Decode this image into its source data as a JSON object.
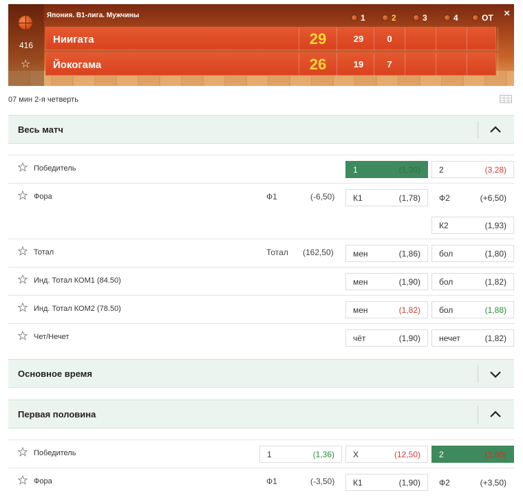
{
  "scoreboard": {
    "league": "Япония. B1-лига. Мужчины",
    "match_id": "416",
    "periods": [
      "1",
      "2",
      "3",
      "4",
      "OT"
    ],
    "teams": [
      {
        "name": "Ниигата",
        "score": "29",
        "q": [
          "29",
          "0",
          "",
          "",
          ""
        ]
      },
      {
        "name": "Йокогама",
        "score": "26",
        "q": [
          "19",
          "7",
          "",
          "",
          ""
        ]
      }
    ],
    "close": "×",
    "star": "☆"
  },
  "match_time": "07 мин 2-я четверть",
  "sections": {
    "whole_match": "Весь матч",
    "regular_time": "Основное время",
    "first_half": "Первая половина"
  },
  "markets": {
    "winner": {
      "name": "Победитель",
      "o1_label": "1",
      "o1": "(1,30)",
      "o2_label": "2",
      "o2": "(3,28)"
    },
    "handicap": {
      "name": "Фора",
      "p1_label": "Ф1",
      "p1": "(-6,50)",
      "k1_label": "К1",
      "k1": "(1,78)",
      "p2_label": "Ф2",
      "p2": "(+6,50)",
      "k2_label": "К2",
      "k2": "(1,93)"
    },
    "total": {
      "name": "Тотал",
      "p_label": "Тотал",
      "p": "(162,50)",
      "under_label": "мен",
      "under": "(1,86)",
      "over_label": "бол",
      "over": "(1,80)"
    },
    "ind_total_1": {
      "name": "Инд. Тотал КОМ1 (84.50)",
      "under_label": "мен",
      "under": "(1,90)",
      "over_label": "бол",
      "over": "(1,82)"
    },
    "ind_total_2": {
      "name": "Инд. Тотал КОМ2 (78.50)",
      "under_label": "мен",
      "under": "(1,82)",
      "over_label": "бол",
      "over": "(1,88)"
    },
    "odd_even": {
      "name": "Чет/Нечет",
      "even_label": "чёт",
      "even": "(1,90)",
      "odd_label": "нечет",
      "odd": "(1,82)"
    },
    "fh_winner": {
      "name": "Победитель",
      "o1_label": "1",
      "o1": "(1,36)",
      "x_label": "X",
      "x": "(12,50)",
      "o2_label": "2",
      "o2": "(3,80)"
    },
    "fh_handicap": {
      "name": "Фора",
      "p1_label": "Ф1",
      "p1": "(-3,50)",
      "k1_label": "К1",
      "k1": "(1,90)",
      "p2_label": "Ф2",
      "p2": "(+3,50)"
    }
  },
  "colors": {
    "selected": "#3e8a5e",
    "odds_up": "#2f8a3c",
    "odds_down": "#d23b3b",
    "section_bg": "#ecf4ef"
  }
}
